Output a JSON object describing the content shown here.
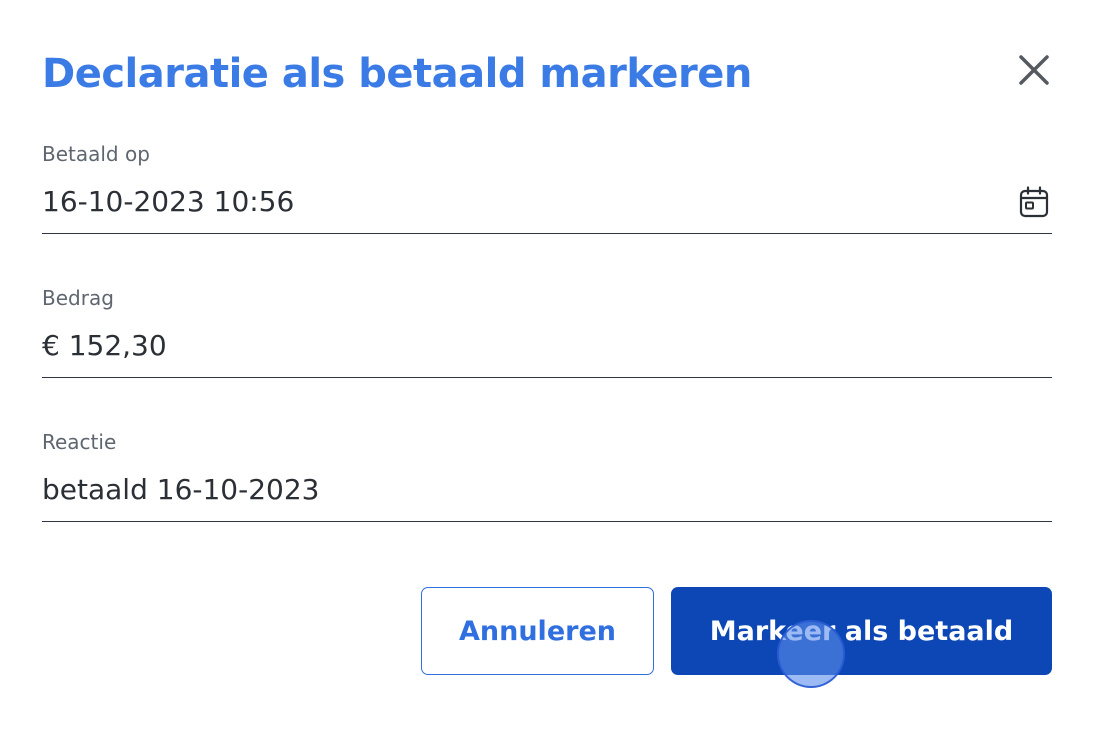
{
  "dialog": {
    "title": "Declaratie als betaald markeren",
    "close_icon": "close-icon"
  },
  "colors": {
    "title": "#3b7be6",
    "primary_button": "#0d47b5",
    "cancel_text": "#2f6fe0",
    "field_underline": "#2f3640",
    "label": "#5f6670"
  },
  "fields": {
    "paid_on": {
      "label": "Betaald op",
      "value": "16-10-2023 10:56",
      "icon": "calendar-icon"
    },
    "amount": {
      "label": "Bedrag",
      "value": "€ 152,30"
    },
    "comment": {
      "label": "Reactie",
      "value": "betaald 16-10-2023"
    }
  },
  "actions": {
    "cancel_label": "Annuleren",
    "confirm_label": "Markeer als betaald"
  }
}
